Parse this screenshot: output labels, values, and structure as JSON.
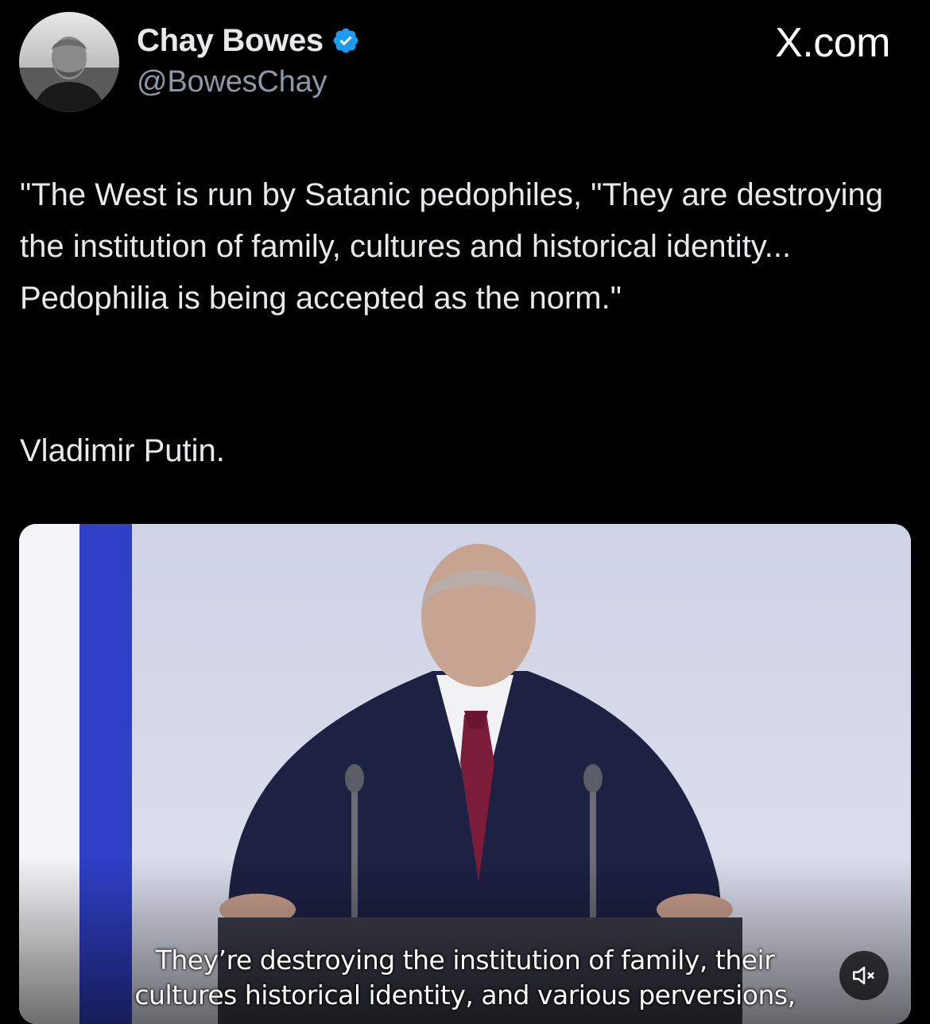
{
  "author": {
    "display_name": "Chay Bowes",
    "handle": "@BowesChay",
    "verified": true,
    "verified_color": "#1d9bf0"
  },
  "brand": {
    "label": "X.com"
  },
  "tweet": {
    "text": "\"The West is run by Satanic pedophiles, \"They are destroying the institution of family, cultures and historical identity... Pedophilia is being accepted as the norm.\"",
    "attribution": "Vladimir Putin."
  },
  "media": {
    "caption_line_1": "They’re destroying the institution of family, their",
    "caption_line_2": "cultures historical identity, and various perversions,",
    "mute_icon": "speaker-muted-icon"
  }
}
